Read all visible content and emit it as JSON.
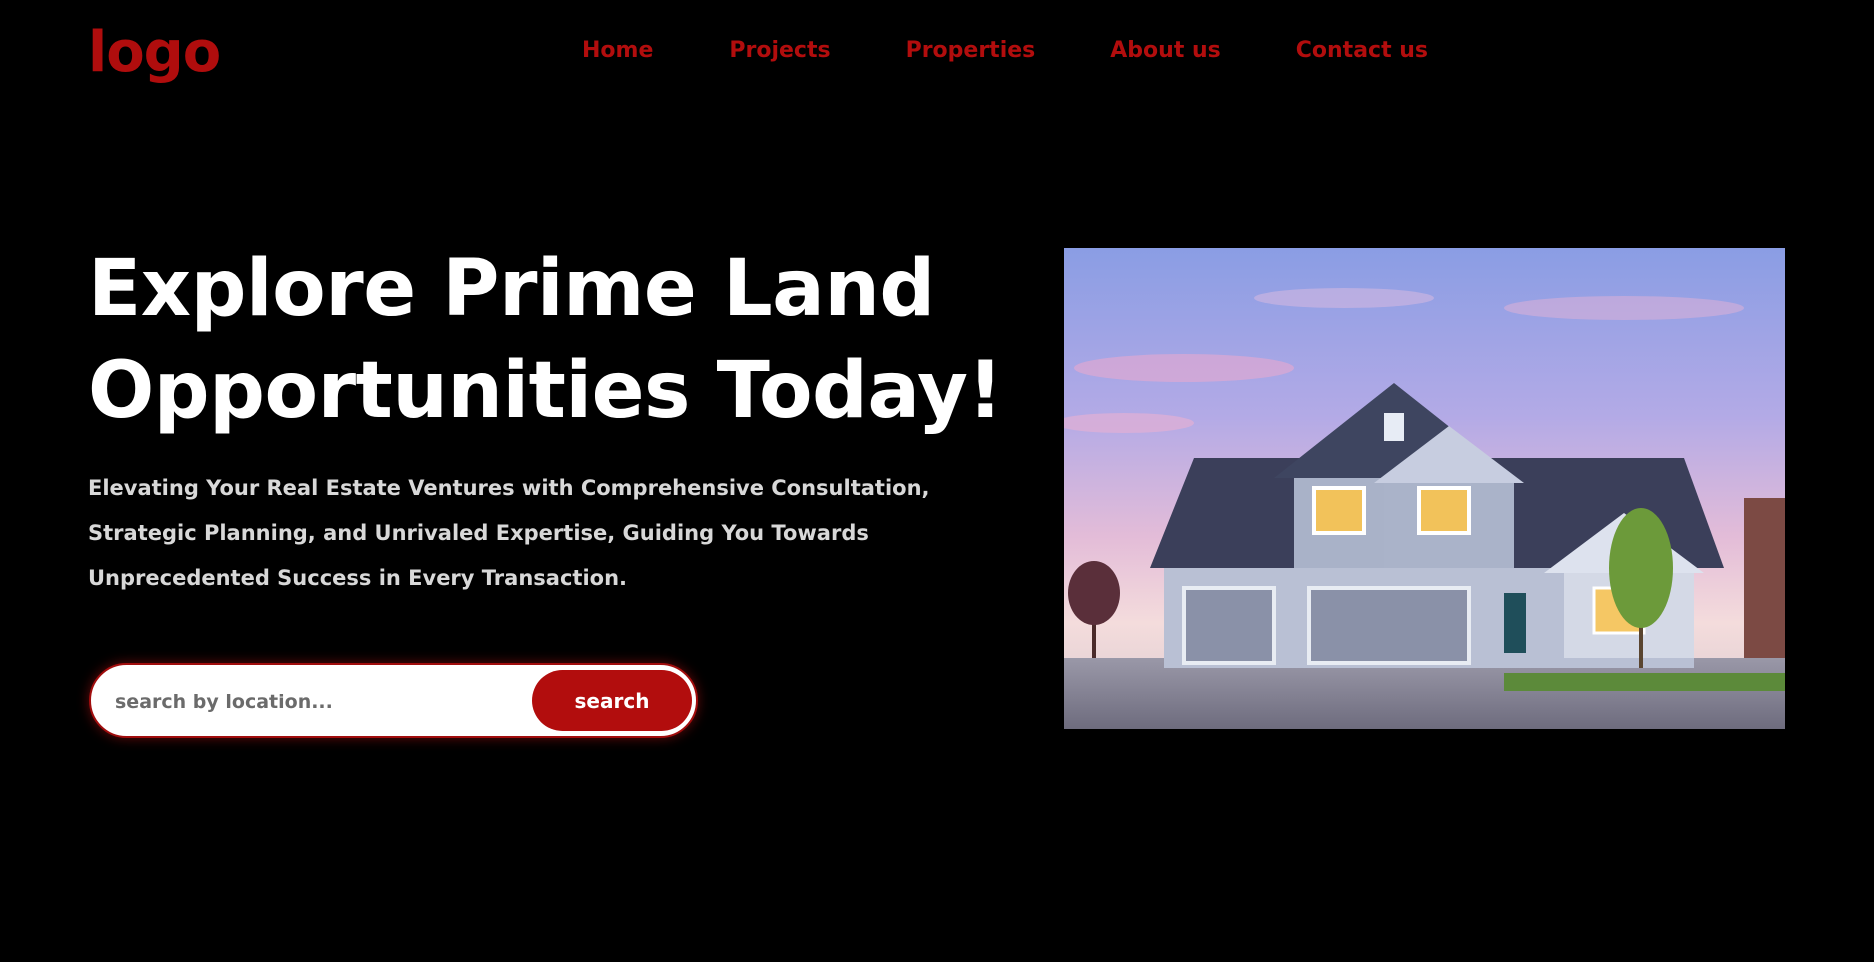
{
  "header": {
    "logo": "logo",
    "nav": [
      "Home",
      "Projects",
      "Properties",
      "About us",
      "Contact us"
    ]
  },
  "hero": {
    "title_line1": "Explore Prime Land",
    "title_line2": "Opportunities Today!",
    "subtitle": "Elevating Your Real Estate Ventures with Comprehensive Consultation, Strategic Planning, and Unrivaled Expertise, Guiding You Towards Unprecedented Success in Every Transaction."
  },
  "search": {
    "placeholder": "search by location...",
    "value": "",
    "button_label": "search"
  },
  "colors": {
    "accent": "#b20d0d",
    "background": "#000000",
    "text": "#ffffff"
  }
}
